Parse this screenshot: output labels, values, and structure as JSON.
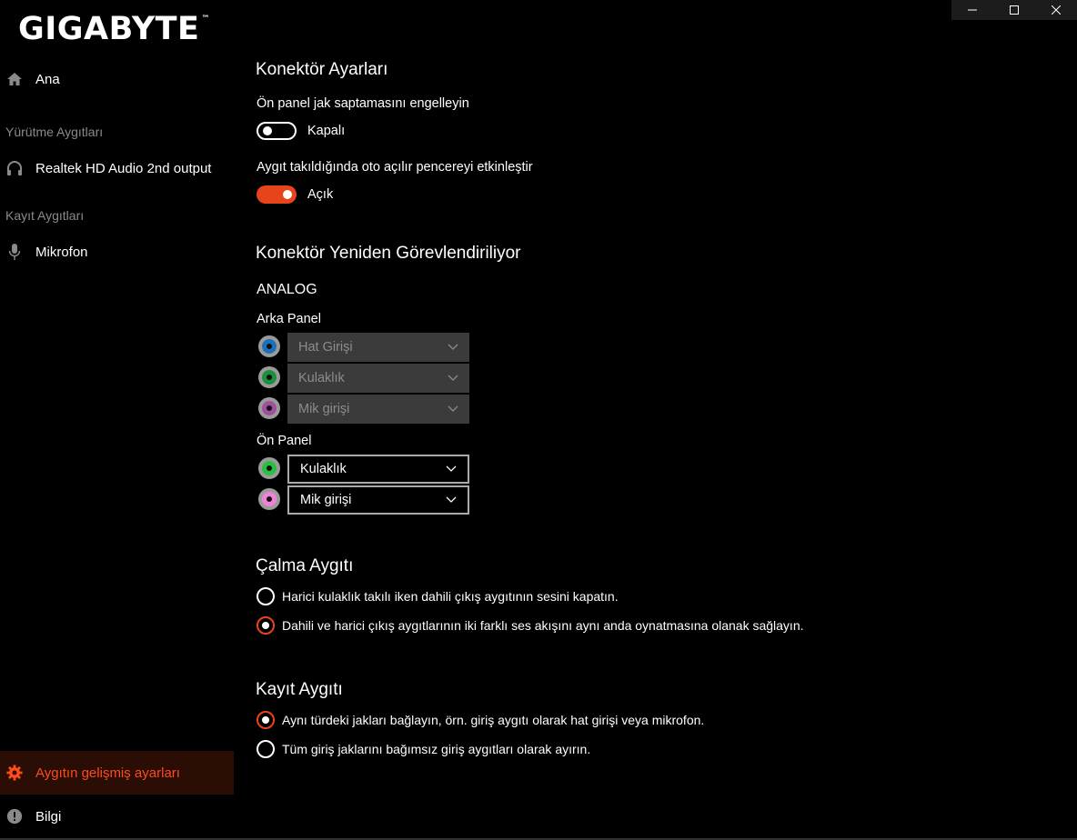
{
  "window_controls": [
    "minimize",
    "maximize",
    "close"
  ],
  "brand": {
    "logo": "GIGABYTE",
    "tm": "™"
  },
  "sidebar": {
    "home": "Ana",
    "playback_section": "Yürütme Aygıtları",
    "playback_device": "Realtek HD Audio 2nd output",
    "recording_section": "Kayıt Aygıtları",
    "recording_device": "Mikrofon",
    "advanced": "Aygıtın gelişmiş ayarları",
    "info": "Bilgi"
  },
  "connector_settings": {
    "title": "Konektör Ayarları",
    "front_jack_label": "Ön panel jak saptamasını engelleyin",
    "front_jack_state": "Kapalı",
    "front_jack_on": false,
    "popup_label": "Aygıt takıldığında oto açılır pencereyi etkinleştir",
    "popup_state": "Açık",
    "popup_on": true
  },
  "retasking": {
    "title": "Konektör Yeniden Görevlendiriliyor",
    "analog": "ANALOG",
    "rear_panel": "Arka Panel",
    "rear": [
      {
        "color": "#1e6fb8",
        "value": "Hat Girişi",
        "enabled": false
      },
      {
        "color": "#1e8f3a",
        "value": "Kulaklık",
        "enabled": false
      },
      {
        "color": "#a0509a",
        "value": "Mik girişi",
        "enabled": false
      }
    ],
    "front_panel": "Ön Panel",
    "front": [
      {
        "color": "#28c040",
        "value": "Kulaklık",
        "enabled": true
      },
      {
        "color": "#ee82d8",
        "value": "Mik girişi",
        "enabled": true
      }
    ]
  },
  "playback": {
    "title": "Çalma Aygıtı",
    "option1": "Harici kulaklık takılı iken dahili çıkış aygıtının sesini kapatın.",
    "option2": "Dahili ve harici çıkış aygıtlarının iki farklı ses akışını aynı anda oynatmasına olanak sağlayın.",
    "selected": 2
  },
  "recording": {
    "title": "Kayıt Aygıtı",
    "option1": "Aynı türdeki jakları bağlayın, örn. giriş aygıtı olarak hat girişi veya mikrofon.",
    "option2": "Tüm giriş jaklarını bağımsız giriş aygıtları olarak ayırın.",
    "selected": 1
  },
  "colors": {
    "accent": "#e8441c",
    "active_bg": "#2a0e06"
  }
}
